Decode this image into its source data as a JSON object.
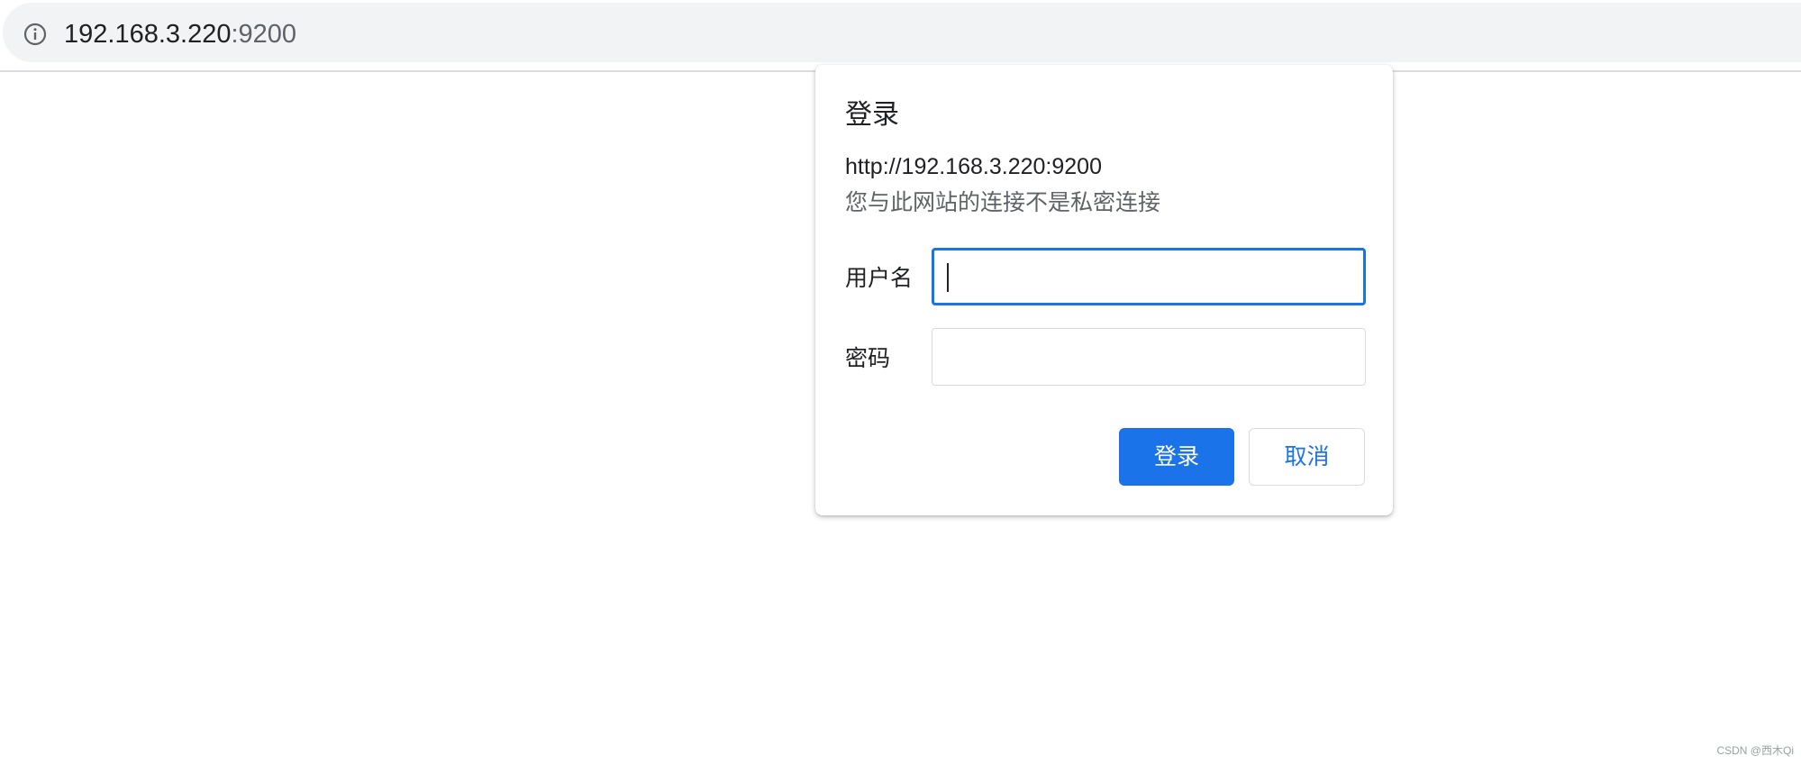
{
  "address_bar": {
    "host": "192.168.3.220",
    "port": ":9200",
    "info_icon": "info-icon"
  },
  "auth_dialog": {
    "title": "登录",
    "origin": "http://192.168.3.220:9200",
    "warning": "您与此网站的连接不是私密连接",
    "username_label": "用户名",
    "username_value": "",
    "password_label": "密码",
    "password_value": "",
    "login_button": "登录",
    "cancel_button": "取消"
  },
  "watermark": "CSDN @西木Qi",
  "colors": {
    "accent": "#1a73e8",
    "omnibox_bg": "#f1f3f4",
    "text_primary": "#202124",
    "text_secondary": "#5f6368"
  }
}
